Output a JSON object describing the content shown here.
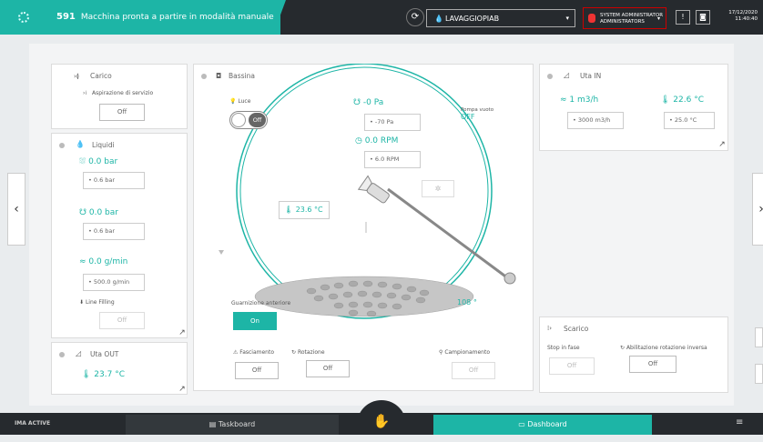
{
  "topbar": {
    "machine_id": "591",
    "status_message": "Macchina pronta a partire in modalità manuale",
    "line_select": "LAVAGGIOPIAB",
    "user_name": "SYSTEM ADMINISTRATOR",
    "user_role": "ADMINISTRATORS",
    "date": "17/12/2020",
    "time": "11:40:40"
  },
  "carico": {
    "title": "Carico",
    "sub_label": "Aspirazione di servizio",
    "button": "Off"
  },
  "liquidi": {
    "title": "Liquidi",
    "pressure1_value": "0.0 bar",
    "pressure1_set": "0.6 bar",
    "pressure2_value": "0.0 bar",
    "pressure2_set": "0.6 bar",
    "flow_value": "0.0 g/min",
    "flow_set": "500.0 g/min",
    "line_filling_label": "Line Filling",
    "line_filling_button": "Off"
  },
  "uta_out": {
    "title": "Uta OUT",
    "temperature": "23.7 °C"
  },
  "bassina": {
    "title": "Bassina",
    "luce_label": "Luce",
    "luce_toggle": "Off",
    "vacuum_value": "-0 Pa",
    "vacuum_set": "-70 Pa",
    "pump_label": "Pompa vuoto",
    "pump_state": "OFF",
    "rpm_value": "0.0 RPM",
    "rpm_set": "6.0 RPM",
    "product_temp": "23.6 °C",
    "angle": "108 °",
    "guarnizione_label": "Guarnizione anteriore",
    "guarnizione_button": "On",
    "fasciamento_label": "Fasciamento",
    "fasciamento_button": "Off",
    "rotazione_label": "Rotazione",
    "rotazione_button": "Off",
    "campionamento_label": "Campionamento",
    "campionamento_button": "Off"
  },
  "uta_in": {
    "title": "Uta IN",
    "airflow_value": "1 m3/h",
    "airflow_set": "3000 m3/h",
    "temp_value": "22.6 °C",
    "temp_set": "25.0 °C"
  },
  "scarico": {
    "title": "Scarico",
    "stop_label": "Stop in fase",
    "stop_button": "Off",
    "reverse_label": "Abilitazione rotazione inversa",
    "reverse_button": "Off"
  },
  "bottombar": {
    "logo": "IMA ACTIVE",
    "taskboard": "Taskboard",
    "dashboard": "Dashboard"
  },
  "colors": {
    "accent": "#1db5a6",
    "dark": "#262a2e",
    "alarm": "#cc0000"
  }
}
